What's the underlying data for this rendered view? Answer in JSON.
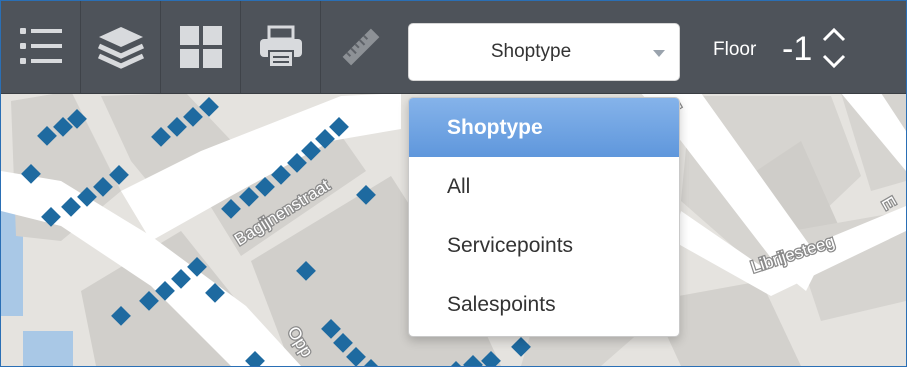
{
  "toolbar": {
    "buttons": [
      {
        "icon": "list-icon"
      },
      {
        "icon": "layers-icon"
      },
      {
        "icon": "grid-icon"
      },
      {
        "icon": "printer-icon"
      },
      {
        "icon": "ruler-icon"
      }
    ],
    "shop_type_select": {
      "value": "Shoptype"
    },
    "floor": {
      "label": "Floor",
      "value": "-1"
    }
  },
  "dropdown": {
    "options": [
      {
        "label": "Shoptype",
        "selected": true
      },
      {
        "label": "All",
        "selected": false
      },
      {
        "label": "Servicepoints",
        "selected": false
      },
      {
        "label": "Salespoints",
        "selected": false
      }
    ]
  },
  "map": {
    "street_labels": [
      "Bagijnenstraat",
      "Librijesteeg",
      "Opp"
    ],
    "colors": {
      "block": "#d2d0cc",
      "street": "#ffffff",
      "marker": "#1e6aa0",
      "water": "#a9c8e6",
      "toolbar": "#4e535a",
      "selected": "#6fa2e2"
    }
  }
}
